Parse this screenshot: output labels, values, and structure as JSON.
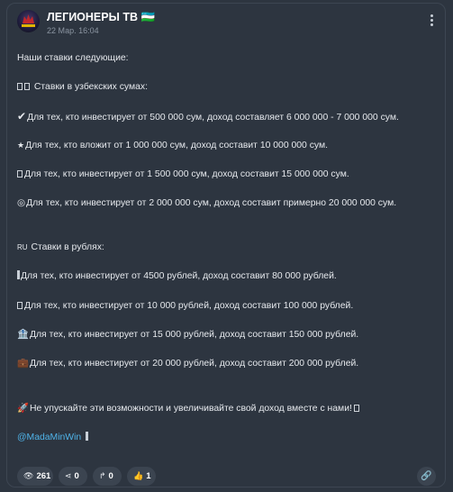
{
  "post": {
    "channel_title": "ЛЕГИОНЕРЫ ТВ 🇺🇿",
    "time": "22 Мар. 16:04",
    "lines": [
      {
        "icon": "",
        "text": "Наши ставки следующие:"
      },
      {
        "icon": "uz-flag-icon",
        "text": "Ставки в узбекских сумах:"
      },
      {
        "icon": "check-icon",
        "text": "Для тех, кто инвестирует от 500 000 сум, доход составляет 6 000 000 - 7 000 000 сум."
      },
      {
        "icon": "star-icon",
        "text": "Для тех, кто вложит от 1 000 000 сум, доход составит 10 000 000 сум."
      },
      {
        "icon": "square-icon",
        "text": "Для тех, кто инвестирует от 1 500 000 сум, доход составит 15 000 000 сум."
      },
      {
        "icon": "target-icon",
        "text": "Для тех, кто инвестирует от 2 000 000 сум, доход составит примерно 20 000 000 сум."
      },
      {
        "icon": "ru-flag-icon",
        "text": "Ставки в рублях:"
      },
      {
        "icon": "bar-icon",
        "text": "Для тех, кто инвестирует от 4500 рублей, доход составит 80 000 рублей."
      },
      {
        "icon": "square-icon",
        "text": "Для тех, кто инвестирует от 10 000 рублей, доход составит 100 000 рублей."
      },
      {
        "icon": "bank-icon",
        "text": "Для тех, кто инвестирует от 15 000 рублей, доход составит 150 000 рублей."
      },
      {
        "icon": "briefcase-icon",
        "text": "Для тех, кто инвестирует от 20 000 рублей, доход составит 200 000 рублей."
      },
      {
        "icon": "rocket-icon",
        "text": "Не упускайте эти возможности и увеличивайте свой доход вместе с нами!"
      }
    ],
    "mention": "@MadaMinWin",
    "ru_flag_text": "RU"
  },
  "footer": {
    "views": "261",
    "shares": "0",
    "forwards": "0",
    "likes": "1"
  },
  "icons": {
    "views": "eye-icon",
    "shares": "share-icon",
    "forwards": "forward-icon",
    "likes": "thumbs-up-icon",
    "link": "link-icon",
    "menu": "more-vertical-icon"
  }
}
